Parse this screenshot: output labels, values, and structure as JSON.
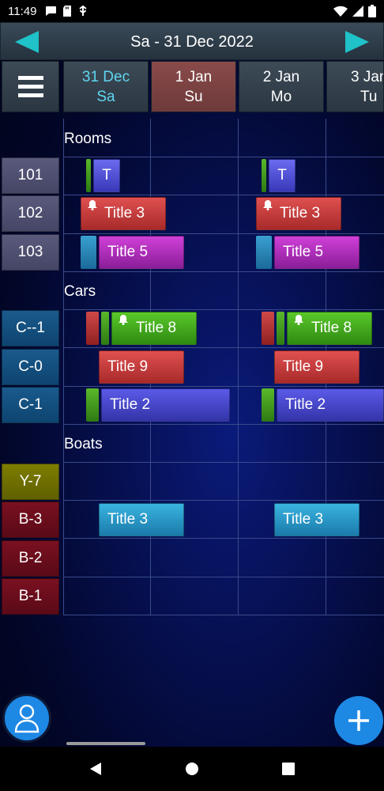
{
  "status_bar": {
    "time": "11:49",
    "icons": [
      "chat-icon",
      "sd-card-icon",
      "usb-icon"
    ],
    "right_icons": [
      "wifi-icon",
      "signal-icon",
      "battery-icon"
    ]
  },
  "header": {
    "title": "Sa - 31 Dec 2022",
    "prev_icon": "chevron-left-icon",
    "next_icon": "chevron-right-icon",
    "accent_color": "#1fc2c8"
  },
  "menu": {
    "icon": "hamburger-icon"
  },
  "days": [
    {
      "date": "31 Dec",
      "weekday": "Sa",
      "state": "today"
    },
    {
      "date": "1 Jan",
      "weekday": "Su",
      "state": "holiday"
    },
    {
      "date": "2 Jan",
      "weekday": "Mo",
      "state": "normal"
    },
    {
      "date": "3 Jan",
      "weekday": "Tu",
      "state": "normal"
    }
  ],
  "sections": {
    "rooms": "Rooms",
    "cars": "Cars",
    "boats": "Boats"
  },
  "resources": {
    "r101": "101",
    "r102": "102",
    "r103": "103",
    "c_m1": "C--1",
    "c_0": "C-0",
    "c_1": "C-1",
    "y_7": "Y-7",
    "b_3": "B-3",
    "b_2": "B-2",
    "b_1": "B-1"
  },
  "events": {
    "t_a": "T",
    "t_b": "T",
    "title3_a": "Title 3",
    "title3_b": "Title 3",
    "title5_a": "Title 5",
    "title5_b": "Title 5",
    "title8_a": "Title 8",
    "title8_b": "Title 8",
    "title9_a": "Title 9",
    "title9_b": "Title 9",
    "title2_a": "Title 2",
    "title2_b": "Title 2",
    "boat3_a": "Title 3",
    "boat3_b": "Title 3"
  },
  "fab": {
    "user_icon": "user-icon",
    "add_icon": "plus-icon"
  },
  "android_nav": [
    "back-icon",
    "home-icon",
    "recents-icon"
  ]
}
